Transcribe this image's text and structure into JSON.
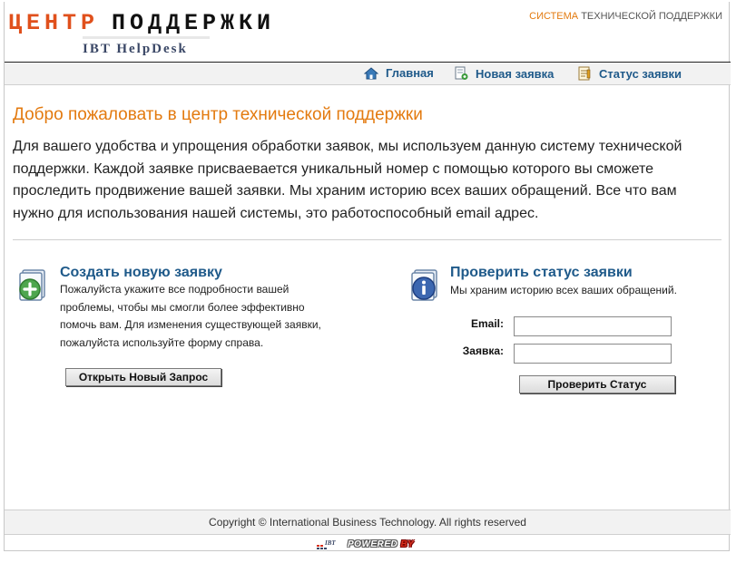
{
  "header": {
    "logo_line1_part1": "ЦЕНТР",
    "logo_line1_part2": "ПОДДЕРЖКИ",
    "logo_line2": "IBT HelpDesk",
    "system_title_accent": "СИСТЕМА",
    "system_title_rest": "ТЕХНИЧЕСКОЙ ПОДДЕРЖКИ"
  },
  "nav": {
    "items": [
      {
        "label": "Главная",
        "icon": "home-icon"
      },
      {
        "label": "Новая заявка",
        "icon": "new-ticket-icon"
      },
      {
        "label": "Статус заявки",
        "icon": "ticket-status-icon"
      }
    ]
  },
  "main": {
    "welcome_title": "Добро пожаловать в центр технической поддержки",
    "welcome_text": "Для вашего удобства и упрощения обработки заявок, мы используем данную систему технической поддержки. Каждой заявке присваевается уникальный номер с помощью которого вы сможете проследить продвижение вашей заявки. Мы храним историю всех ваших обращений. Все что вам нужно для использования нашей системы, это работоспособный email адрес.",
    "new_ticket": {
      "title": "Создать новую заявку",
      "text": "Пожалуйста укажите все подробности вашей проблемы, чтобы мы смогли более эффективно помочь вам. Для изменения существующей заявки, пожалуйста используйте форму справа.",
      "button_label": "Открыть Новый Запрос"
    },
    "check_status": {
      "title": "Проверить статус заявки",
      "text": "Мы храним историю всех ваших обращений.",
      "email_label": "Email:",
      "email_value": "",
      "ticket_label": "Заявка:",
      "ticket_value": "",
      "button_label": "Проверить Статус"
    }
  },
  "footer": {
    "copyright": "Copyright © International Business Technology. All rights reserved",
    "powered_logo_text": "IBT",
    "powered_text": "POWERED",
    "powered_by": "BY"
  },
  "colors": {
    "accent": "#e37a0f",
    "link": "#1f5a8a",
    "logo_red": "#e0501c"
  }
}
